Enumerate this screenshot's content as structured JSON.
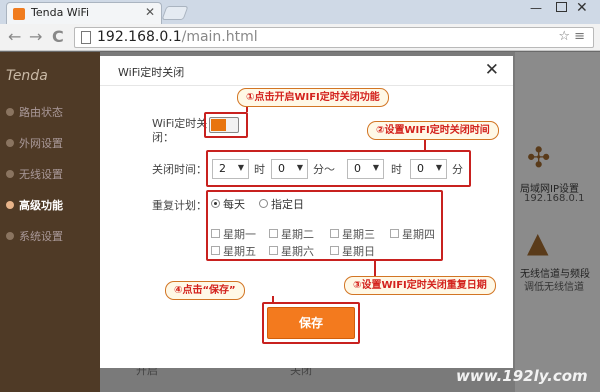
{
  "browser": {
    "tab_title": "Tenda WiFi",
    "tab_close": "✕",
    "url_host": "192.168.0.1",
    "url_path": "/main.html",
    "back": "←",
    "forward": "→",
    "reload": "C",
    "omni_icons": "☆ ≡",
    "win_min": "—",
    "win_close": "✕"
  },
  "sidebar": {
    "logo": "Tenda",
    "items": [
      {
        "label": "路由状态"
      },
      {
        "label": "外网设置"
      },
      {
        "label": "无线设置"
      },
      {
        "label": "高级功能",
        "active": true
      },
      {
        "label": "系统设置"
      }
    ]
  },
  "right_pane": {
    "item1_label": "局域网IP设置",
    "item1_sub": "192.168.0.1",
    "item2_label": "无线信道与频段",
    "item2_sub": "调低无线信道"
  },
  "background_labels": {
    "left": "开启",
    "right": "关闭"
  },
  "modal": {
    "title": "WiFi定时关闭",
    "close": "✕",
    "switch_label": "WiFi定时关闭：",
    "time_label": "关闭时间：",
    "start_hour": "2",
    "start_minute": "0",
    "end_hour": "0",
    "end_minute": "0",
    "hour_unit": "时",
    "minute_unit": "分～",
    "minute_unit_end": "分",
    "repeat_label": "重复计划：",
    "repeat_options": [
      "每天",
      "指定日"
    ],
    "repeat_selected": "每天",
    "days": [
      "星期一",
      "星期二",
      "星期三",
      "星期四",
      "星期五",
      "星期六",
      "星期日"
    ],
    "save_label": "保存"
  },
  "annotations": {
    "step1": "①点击开启WIFI定时关闭功能",
    "step2": "②设置WIFI定时关闭时间",
    "step3": "③设置WIFI定时关闭重复日期",
    "step4": "④点击“保存”"
  },
  "colors": {
    "accent": "#f37a1e",
    "annotation_red": "#c8211f"
  },
  "watermark": "www.192ly.com"
}
